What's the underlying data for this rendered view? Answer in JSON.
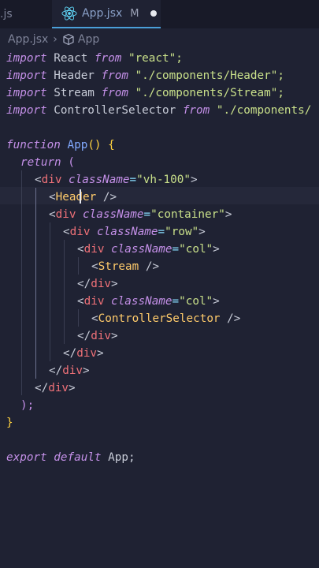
{
  "tabs": {
    "prev_label": ".js",
    "active_label": "App.jsx",
    "active_status": "M"
  },
  "breadcrumb": {
    "folder": "App.jsx",
    "symbol": "App"
  },
  "code": {
    "l1": [
      "import",
      " React ",
      "from",
      " \"react\";"
    ],
    "l2": [
      "import",
      " Header ",
      "from",
      " \"./components/Header\";"
    ],
    "l3": [
      "import",
      " Stream ",
      "from",
      " \"./components/Stream\";"
    ],
    "l4": [
      "import",
      " ControllerSelector ",
      "from",
      " \"./components/"
    ],
    "l6": [
      "function",
      " App",
      "()",
      " {"
    ],
    "l7": [
      "return",
      " ("
    ],
    "l8": [
      "<",
      "div",
      " ",
      "className",
      "=",
      "\"vh-100\"",
      ">"
    ],
    "l9": [
      "<",
      "Header",
      " />"
    ],
    "l10": [
      "<",
      "div",
      " ",
      "className",
      "=",
      "\"container\"",
      ">"
    ],
    "l11": [
      "<",
      "div",
      " ",
      "className",
      "=",
      "\"row\"",
      ">"
    ],
    "l12": [
      "<",
      "div",
      " ",
      "className",
      "=",
      "\"col\"",
      ">"
    ],
    "l13": [
      "<",
      "Stream",
      " />"
    ],
    "l14": [
      "</",
      "div",
      ">"
    ],
    "l15": [
      "<",
      "div",
      " ",
      "className",
      "=",
      "\"col\"",
      ">"
    ],
    "l16": [
      "<",
      "ControllerSelector",
      " />"
    ],
    "l17": [
      "</",
      "div",
      ">"
    ],
    "l18": [
      "</",
      "div",
      ">"
    ],
    "l19": [
      "</",
      "div",
      ">"
    ],
    "l20": [
      "</",
      "div",
      ">"
    ],
    "l21": [
      ");"
    ],
    "l22": [
      "}"
    ],
    "l24": [
      "export",
      " ",
      "default",
      " App;"
    ]
  }
}
